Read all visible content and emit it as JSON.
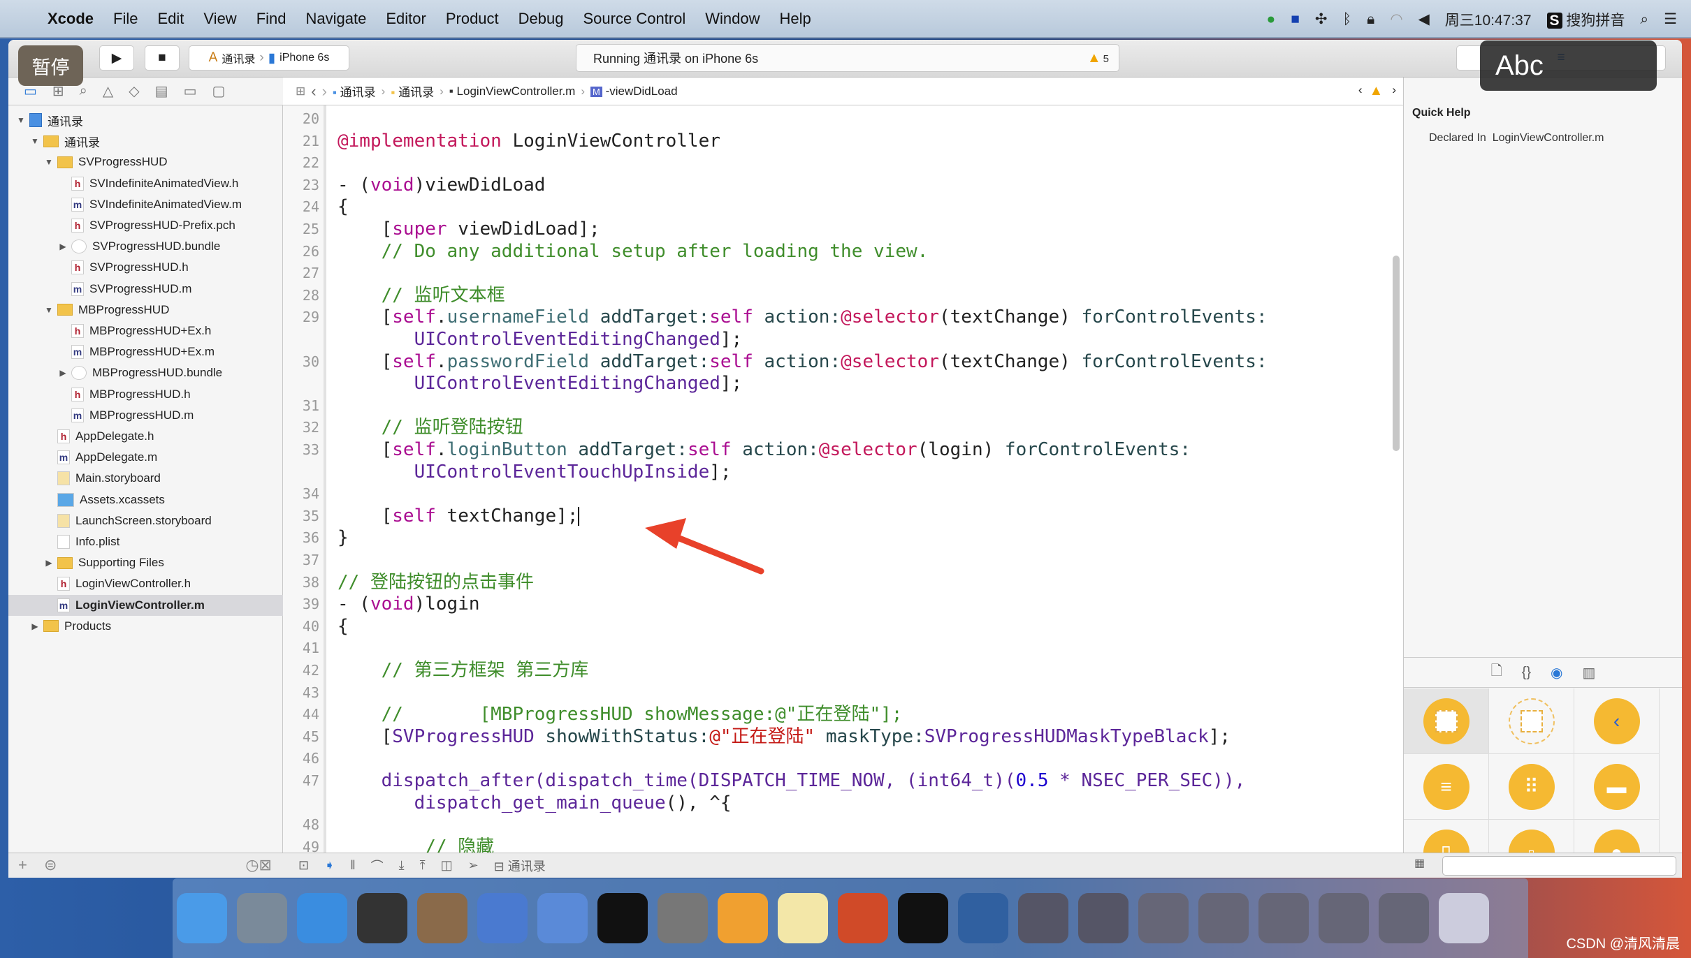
{
  "menubar": {
    "app": "Xcode",
    "items": [
      "File",
      "Edit",
      "View",
      "Find",
      "Navigate",
      "Editor",
      "Product",
      "Debug",
      "Source Control",
      "Window",
      "Help"
    ],
    "status_icons": [
      "record-icon",
      "camera-icon",
      "fan-icon",
      "bluetooth-icon",
      "lock-icon",
      "wifi-icon",
      "volume-icon"
    ],
    "clock": "周三10:47:37",
    "input_method": "搜狗拼音"
  },
  "toolbar": {
    "scheme": "通讯录",
    "device": "iPhone 6s",
    "activity": "Running 通讯录 on iPhone 6s",
    "warning_count": "5"
  },
  "overlay": {
    "pause": "暂停",
    "abc": "Abc"
  },
  "jumpbar": [
    "通讯录",
    "通讯录",
    "LoginViewController.m",
    "-viewDidLoad"
  ],
  "navigator": [
    {
      "label": "通讯录",
      "icon": "proj",
      "lvl": 0,
      "disc": "open"
    },
    {
      "label": "通讯录",
      "icon": "folder",
      "lvl": 1,
      "disc": "open"
    },
    {
      "label": "SVProgressHUD",
      "icon": "folder",
      "lvl": 2,
      "disc": "open"
    },
    {
      "label": "SVIndefiniteAnimatedView.h",
      "icon": "h",
      "lvl": 3
    },
    {
      "label": "SVIndefiniteAnimatedView.m",
      "icon": "m",
      "lvl": 3
    },
    {
      "label": "SVProgressHUD-Prefix.pch",
      "icon": "h",
      "lvl": 3
    },
    {
      "label": "SVProgressHUD.bundle",
      "icon": "bundle",
      "lvl": 3,
      "disc": "closed"
    },
    {
      "label": "SVProgressHUD.h",
      "icon": "h",
      "lvl": 3
    },
    {
      "label": "SVProgressHUD.m",
      "icon": "m",
      "lvl": 3
    },
    {
      "label": "MBProgressHUD",
      "icon": "folder",
      "lvl": 2,
      "disc": "open"
    },
    {
      "label": "MBProgressHUD+Ex.h",
      "icon": "h",
      "lvl": 3
    },
    {
      "label": "MBProgressHUD+Ex.m",
      "icon": "m",
      "lvl": 3
    },
    {
      "label": "MBProgressHUD.bundle",
      "icon": "bundle",
      "lvl": 3,
      "disc": "closed"
    },
    {
      "label": "MBProgressHUD.h",
      "icon": "h",
      "lvl": 3
    },
    {
      "label": "MBProgressHUD.m",
      "icon": "m",
      "lvl": 3
    },
    {
      "label": "AppDelegate.h",
      "icon": "h",
      "lvl": 2
    },
    {
      "label": "AppDelegate.m",
      "icon": "m",
      "lvl": 2
    },
    {
      "label": "Main.storyboard",
      "icon": "sb",
      "lvl": 2
    },
    {
      "label": "Assets.xcassets",
      "icon": "assets",
      "lvl": 2
    },
    {
      "label": "LaunchScreen.storyboard",
      "icon": "sb",
      "lvl": 2
    },
    {
      "label": "Info.plist",
      "icon": "plist",
      "lvl": 2
    },
    {
      "label": "Supporting Files",
      "icon": "folder",
      "lvl": 2,
      "disc": "closed"
    },
    {
      "label": "LoginViewController.h",
      "icon": "h",
      "lvl": 2
    },
    {
      "label": "LoginViewController.m",
      "icon": "m",
      "lvl": 2,
      "selected": true
    },
    {
      "label": "Products",
      "icon": "folder",
      "lvl": 1,
      "disc": "closed"
    }
  ],
  "code": [
    {
      "n": "20",
      "s": []
    },
    {
      "n": "21",
      "s": [
        [
          "@implementation",
          "di"
        ],
        [
          " LoginViewController",
          ""
        ]
      ]
    },
    {
      "n": "22",
      "s": []
    },
    {
      "n": "23",
      "s": [
        [
          "- (",
          ""
        ],
        [
          "void",
          "kw"
        ],
        [
          ")viewDidLoad",
          ""
        ]
      ]
    },
    {
      "n": "24",
      "s": [
        [
          "{",
          ""
        ]
      ]
    },
    {
      "n": "25",
      "s": [
        [
          "    [",
          ""
        ],
        [
          "super",
          "kw"
        ],
        [
          " viewDidLoad];",
          ""
        ]
      ]
    },
    {
      "n": "26",
      "s": [
        [
          "    // Do any additional setup after loading the view.",
          "cm"
        ]
      ]
    },
    {
      "n": "27",
      "s": []
    },
    {
      "n": "28",
      "s": [
        [
          "    // 监听文本框",
          "cm"
        ]
      ]
    },
    {
      "n": "29",
      "s": [
        [
          "    [",
          ""
        ],
        [
          "self",
          "kw"
        ],
        [
          ".",
          ""
        ],
        [
          "usernameField",
          "pr"
        ],
        [
          " addTarget:",
          "me"
        ],
        [
          "self",
          "kw"
        ],
        [
          " action:",
          "me"
        ],
        [
          "@selector",
          "di"
        ],
        [
          "(textChange) ",
          ""
        ],
        [
          "forControlEvents:",
          "me"
        ]
      ]
    },
    {
      "n": "",
      "s": [
        [
          "       ",
          ""
        ],
        [
          "UIControlEventEditingChanged",
          "ty"
        ],
        [
          "];",
          ""
        ]
      ]
    },
    {
      "n": "30",
      "s": [
        [
          "    [",
          ""
        ],
        [
          "self",
          "kw"
        ],
        [
          ".",
          ""
        ],
        [
          "passwordField",
          "pr"
        ],
        [
          " addTarget:",
          "me"
        ],
        [
          "self",
          "kw"
        ],
        [
          " action:",
          "me"
        ],
        [
          "@selector",
          "di"
        ],
        [
          "(textChange) ",
          ""
        ],
        [
          "forControlEvents:",
          "me"
        ]
      ]
    },
    {
      "n": "",
      "s": [
        [
          "       ",
          ""
        ],
        [
          "UIControlEventEditingChanged",
          "ty"
        ],
        [
          "];",
          ""
        ]
      ]
    },
    {
      "n": "31",
      "s": []
    },
    {
      "n": "32",
      "s": [
        [
          "    // 监听登陆按钮",
          "cm"
        ]
      ]
    },
    {
      "n": "33",
      "s": [
        [
          "    [",
          ""
        ],
        [
          "self",
          "kw"
        ],
        [
          ".",
          ""
        ],
        [
          "loginButton",
          "pr"
        ],
        [
          " addTarget:",
          "me"
        ],
        [
          "self",
          "kw"
        ],
        [
          " action:",
          "me"
        ],
        [
          "@selector",
          "di"
        ],
        [
          "(login) ",
          ""
        ],
        [
          "forControlEvents:",
          "me"
        ]
      ]
    },
    {
      "n": "",
      "s": [
        [
          "       ",
          ""
        ],
        [
          "UIControlEventTouchUpInside",
          "ty"
        ],
        [
          "];",
          ""
        ]
      ]
    },
    {
      "n": "34",
      "s": []
    },
    {
      "n": "35",
      "s": [
        [
          "    [",
          ""
        ],
        [
          "self",
          "kw"
        ],
        [
          " textChange];",
          ""
        ]
      ],
      "cursor": true
    },
    {
      "n": "36",
      "s": [
        [
          "}",
          ""
        ]
      ]
    },
    {
      "n": "37",
      "s": []
    },
    {
      "n": "38",
      "s": [
        [
          "// 登陆按钮的点击事件",
          "cm"
        ]
      ]
    },
    {
      "n": "39",
      "s": [
        [
          "- (",
          ""
        ],
        [
          "void",
          "kw"
        ],
        [
          ")login",
          ""
        ]
      ]
    },
    {
      "n": "40",
      "s": [
        [
          "{",
          ""
        ]
      ]
    },
    {
      "n": "41",
      "s": []
    },
    {
      "n": "42",
      "s": [
        [
          "    // 第三方框架 第三方库",
          "cm"
        ]
      ]
    },
    {
      "n": "43",
      "s": []
    },
    {
      "n": "44",
      "s": [
        [
          "    //       [MBProgressHUD showMessage:@\"正在登陆\"];",
          "cm"
        ]
      ]
    },
    {
      "n": "45",
      "s": [
        [
          "    [",
          ""
        ],
        [
          "SVProgressHUD",
          "ty"
        ],
        [
          " showWithStatus:",
          "me"
        ],
        [
          "@\"正在登陆\"",
          "st"
        ],
        [
          " maskType:",
          "me"
        ],
        [
          "SVProgressHUDMaskTypeBlack",
          "ty"
        ],
        [
          "];",
          ""
        ]
      ]
    },
    {
      "n": "46",
      "s": []
    },
    {
      "n": "47",
      "s": [
        [
          "    ",
          ""
        ],
        [
          "dispatch_after(dispatch_time(DISPATCH_TIME_NOW, (int64_t)(",
          "ty"
        ],
        [
          "0.5",
          "nu"
        ],
        [
          " * NSEC_PER_SEC)),",
          "ty"
        ]
      ]
    },
    {
      "n": "",
      "s": [
        [
          "       ",
          ""
        ],
        [
          "dispatch_get_main_queue",
          "ty"
        ],
        [
          "(), ^{",
          ""
        ]
      ]
    },
    {
      "n": "48",
      "s": []
    },
    {
      "n": "49",
      "s": [
        [
          "        // 隐藏",
          "cm"
        ]
      ]
    }
  ],
  "inspector": {
    "title": "Quick Help",
    "declared_label": "Declared In",
    "declared_value": "LoginViewController.m",
    "library_tabs": [
      "file-template-icon",
      "code-snippet-icon",
      "object-library-icon",
      "media-library-icon"
    ],
    "objects": [
      "view-controller",
      "storyboard-reference",
      "navigation-controller",
      "table-view-controller",
      "collection-view-controller",
      "tab-bar-controller",
      "split-view-controller",
      "page-view-controller",
      "glkit-view-controller"
    ]
  },
  "debugbar": {
    "target": "通讯录"
  },
  "dock": [
    "finder",
    "launchpad",
    "safari",
    "mouse",
    "photo-booth",
    "xcode",
    "instruments",
    "terminal",
    "system-preferences",
    "sketch",
    "notes",
    "powerpoint",
    "exec",
    "quicktime",
    "window1",
    "window2",
    "window3",
    "window4",
    "window5",
    "window6",
    "window7",
    "trash"
  ],
  "watermark": "CSDN @清风清晨",
  "colors": {
    "annotation_arrow": "#e8412a",
    "keyword": "#aa0d91",
    "comment": "#3f8d2b",
    "string": "#c41a16",
    "type": "#5c2699"
  }
}
